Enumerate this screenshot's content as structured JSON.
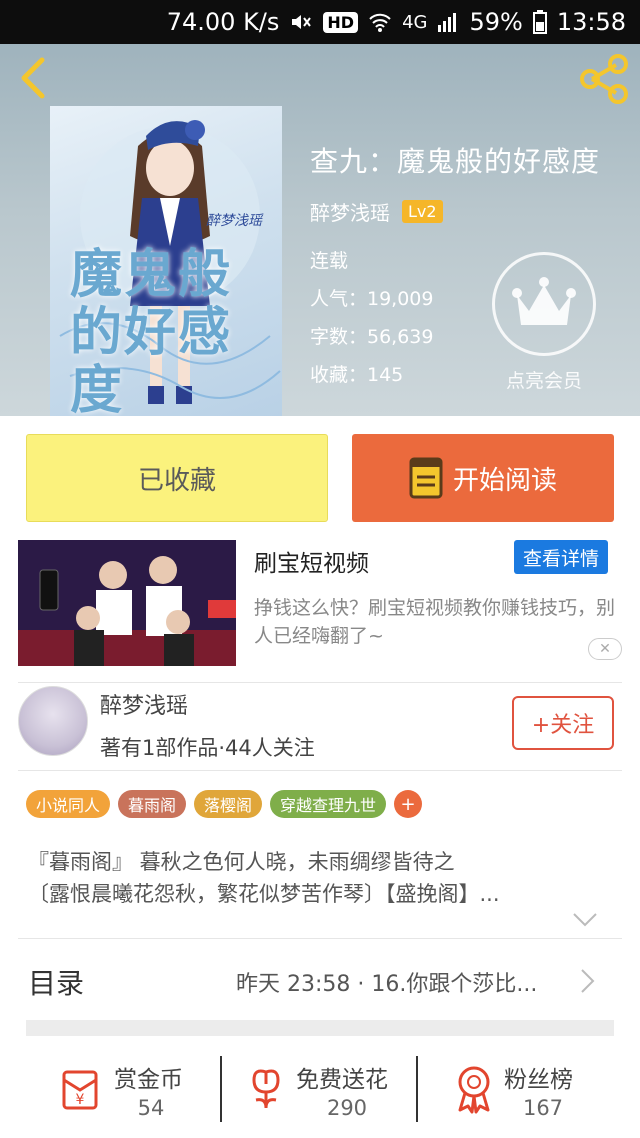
{
  "status_bar": {
    "net_speed": "74.00 K/s",
    "hd": "HD",
    "network": "4G",
    "battery": "59%",
    "time": "13:58"
  },
  "book": {
    "title": "查九：魔鬼般的好感度",
    "author": "醉梦浅瑶",
    "level": "Lv2",
    "status": "连载",
    "popularity": "人气：19,009",
    "word_count": "字数：56,639",
    "favorites": "收藏：145",
    "cover_text": "魔鬼般的好感度",
    "cover_author": "醉梦浅瑶"
  },
  "vip": {
    "label": "点亮会员"
  },
  "actions": {
    "favorited_label": "已收藏",
    "start_reading_label": "开始阅读"
  },
  "ad": {
    "title": "刷宝短视频",
    "detail_label": "查看详情",
    "description": "挣钱这么快？刷宝短视频教你赚钱技巧，别人已经嗨翻了~",
    "close": "✕"
  },
  "author_profile": {
    "name": "醉梦浅瑶",
    "stats": "著有1部作品·44人关注",
    "follow_label": "+关注"
  },
  "tags": [
    {
      "label": "小说同人",
      "color": "#f2a33a"
    },
    {
      "label": "暮雨阁",
      "color": "#c9735b"
    },
    {
      "label": "落樱阁",
      "color": "#e0a63a"
    },
    {
      "label": "穿越查理九世",
      "color": "#7fae4a"
    }
  ],
  "tag_add": "+",
  "intro": {
    "line1": "『暮雨阁』 暮秋之色何人晓，未雨绸缪皆待之",
    "line2": "〔露恨晨曦花怨秋，繁花似梦苦作琴〕【盛挽阁】..."
  },
  "toc": {
    "label": "目录",
    "latest": "昨天 23:58 · 16.你跟个莎比..."
  },
  "bottom_stats": [
    {
      "label": "赏金币",
      "value": "54",
      "icon": "red-envelope-icon"
    },
    {
      "label": "免费送花",
      "value": "290",
      "icon": "flower-icon"
    },
    {
      "label": "粉丝榜",
      "value": "167",
      "icon": "medal-icon"
    }
  ],
  "colors": {
    "accent_orange": "#eb6a3d",
    "favorite_yellow": "#fbf27d",
    "ad_blue": "#1b7ae0",
    "follow_red": "#e0533f",
    "icon_red": "#e2452e"
  }
}
